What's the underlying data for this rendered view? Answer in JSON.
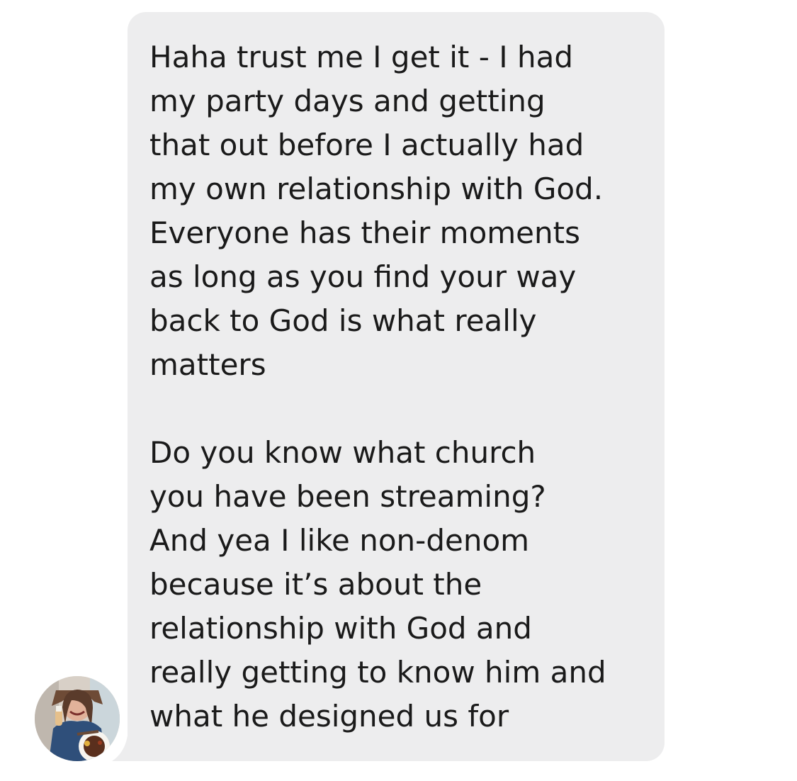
{
  "conversation": {
    "message": {
      "text": "Haha trust me I get it - I had\nmy party days and getting\nthat out before I actually had\nmy own relationship with God.\nEveryone has their moments\nas long as you find your way\nback to God is what really\nmatters\n\nDo you know what church\nyou have been streaming?\nAnd yea I like non-denom\nbecause it’s about the\nrelationship with God and\nreally getting to know him and\nwhat he designed us for",
      "bubble_color": "#ededee",
      "text_color": "#1a1a1a"
    },
    "avatar": {
      "icon": "user-photo-avatar"
    }
  }
}
